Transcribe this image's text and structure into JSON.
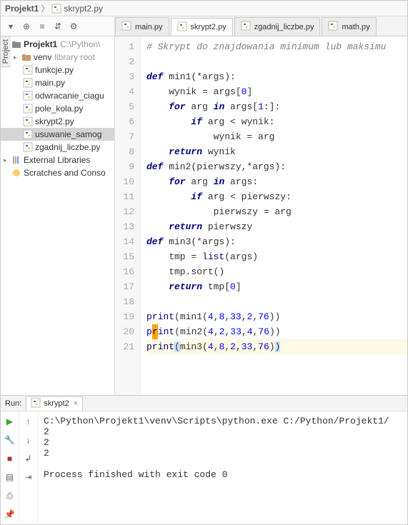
{
  "breadcrumb": {
    "project": "Projekt1",
    "file": "skrypt2.py"
  },
  "sidebar": {
    "toolbar_icons": [
      "project-dropdown",
      "target-icon",
      "expand-icon",
      "collapse-icon",
      "settings-icon"
    ]
  },
  "project_tree": {
    "root": {
      "name": "Projekt1",
      "hint": "C:\\Python\\"
    },
    "venv": {
      "name": "venv",
      "hint": "library root"
    },
    "files": [
      "funkcje.py",
      "main.py",
      "odwracanie_ciagu",
      "pole_kola.py",
      "skrypt2.py",
      "usuwanie_samog",
      "zgadnij_liczbe.py"
    ],
    "external_libs": "External Libraries",
    "scratches": "Scratches and Conso"
  },
  "project_tab_label": "Project",
  "editor_tabs": [
    {
      "label": "main.py",
      "active": false
    },
    {
      "label": "skrypt2.py",
      "active": true
    },
    {
      "label": "zgadnij_liczbe.py",
      "active": false
    },
    {
      "label": "math.py",
      "active": false
    }
  ],
  "code": {
    "lines": [
      "# Skrypt do znajdowania minimum lub maksimu",
      "",
      "def min1(*args):",
      "    wynik = args[0]",
      "    for arg in args[1:]:",
      "        if arg < wynik:",
      "            wynik = arg",
      "    return wynik",
      "def min2(pierwszy,*args):",
      "    for arg in args:",
      "        if arg < pierwszy:",
      "            pierwszy = arg",
      "    return pierwszy",
      "def min3(*args):",
      "    tmp = list(args)",
      "    tmp.sort()",
      "    return tmp[0]",
      "",
      "print(min1(4,8,33,2,76))",
      "print(min2(4,2,33,4,76))",
      "print(min3(4,8,2,33,76))"
    ],
    "current_line": 21
  },
  "run": {
    "label": "Run:",
    "tab": "skrypt2",
    "output": [
      "C:\\Python\\Projekt1\\venv\\Scripts\\python.exe C:/Python/Projekt1/",
      "2",
      "2",
      "2",
      "",
      "Process finished with exit code 0"
    ]
  }
}
